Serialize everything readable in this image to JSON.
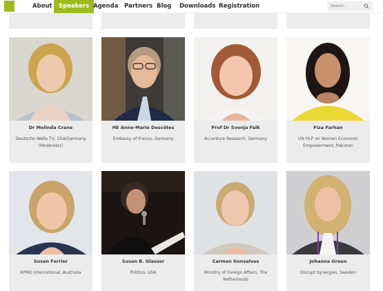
{
  "nav": {
    "items": [
      "About",
      "Speakers",
      "Agenda",
      "Partners",
      "Blog",
      "Downloads",
      "Registration"
    ],
    "active": "Speakers",
    "search_placeholder": "Search..."
  },
  "colors": {
    "accent": "#9dbb1f",
    "card_bg": "#ececec"
  },
  "speakers": [
    {
      "name": "Dr Melinda Crane",
      "affiliation": "Deutsche Welle TV, USA/Germany (Moderator)"
    },
    {
      "name": "HE Anne-Marie Descôtes",
      "affiliation": "Embassy of France, Germany"
    },
    {
      "name": "Prof Dr Svenja Falk",
      "affiliation": "Accenture Research, Germany"
    },
    {
      "name": "Fiza Farhan",
      "affiliation": "UN HLP on Women Economic Empowerment, Pakistan"
    },
    {
      "name": "Susan Ferrier",
      "affiliation": "KPMG International, Australia"
    },
    {
      "name": "Susan B. Glasser",
      "affiliation": "Politico, USA"
    },
    {
      "name": "Carmen Gonsalves",
      "affiliation": "Ministry of Foreign Affairs, The Netherlands"
    },
    {
      "name": "Johanna Green",
      "affiliation": "Disrupt Synergies, Sweden"
    }
  ]
}
